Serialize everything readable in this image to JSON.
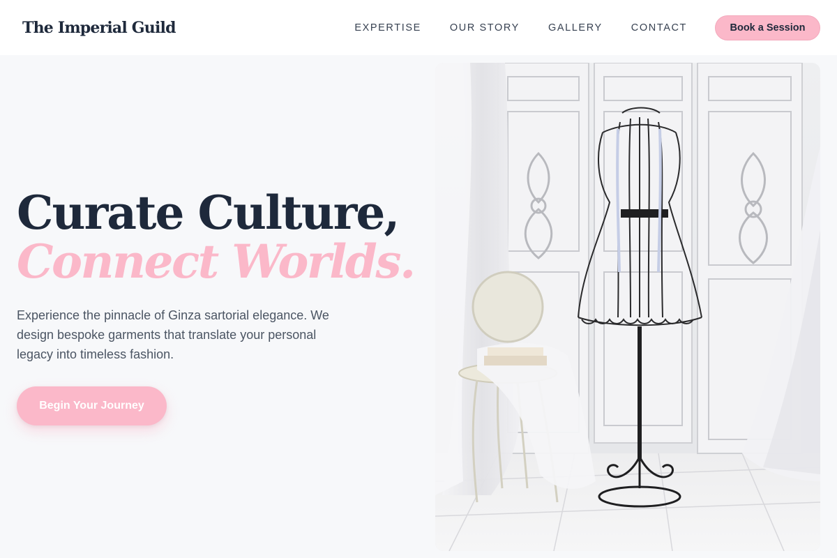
{
  "header": {
    "logo": "The Imperial Guild",
    "nav": [
      {
        "label": "EXPERTISE"
      },
      {
        "label": "OUR STORY"
      },
      {
        "label": "GALLERY"
      },
      {
        "label": "CONTACT"
      }
    ],
    "cta_label": "Book a Session"
  },
  "hero": {
    "title_line1": "Curate Culture,",
    "title_line2": "Connect Worlds.",
    "description": "Experience the pinnacle of Ginza sartorial elegance. We design bespoke garments that translate your personal legacy into timeless fashion.",
    "cta_label": "Begin Your Journey",
    "image_subject": "dress-form-mannequin-photo"
  },
  "colors": {
    "accent_pink": "#fbb8c9",
    "navy": "#1e293b",
    "body_text": "#4b5563",
    "background": "#f7f8fa"
  }
}
